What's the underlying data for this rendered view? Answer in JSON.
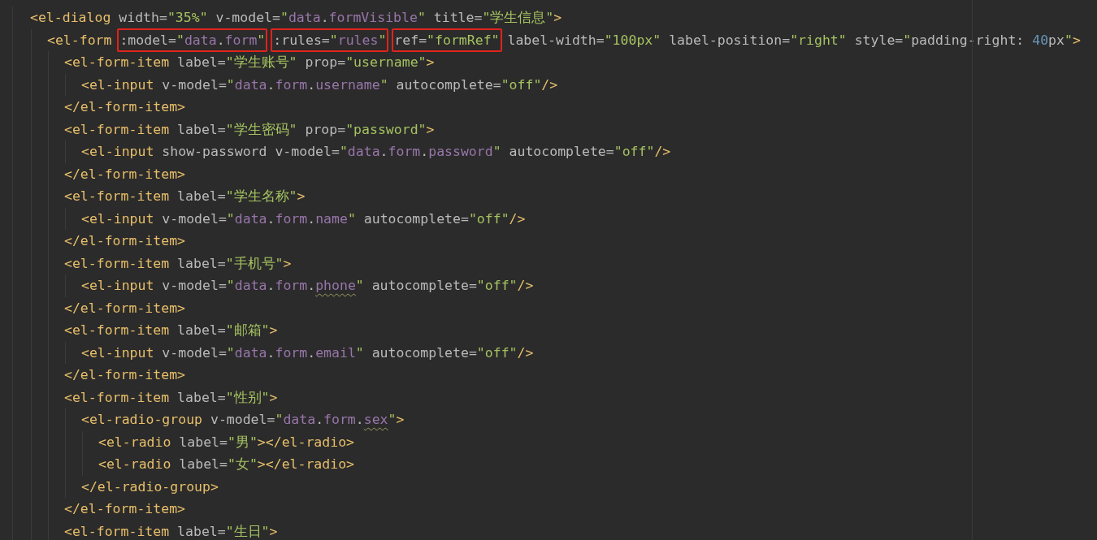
{
  "editor": {
    "lines": [
      {
        "tokens": [
          {
            "kind": "tag",
            "text": "<el-dialog "
          },
          {
            "kind": "attr",
            "text": "width="
          },
          {
            "kind": "str",
            "text": "\"35%\" "
          },
          {
            "kind": "attr",
            "text": "v-model="
          },
          {
            "kind": "str",
            "text": "\""
          },
          {
            "kind": "ref",
            "text": "data"
          },
          {
            "kind": "attr",
            "text": "."
          },
          {
            "kind": "ref",
            "text": "formVisible"
          },
          {
            "kind": "str",
            "text": "\" "
          },
          {
            "kind": "attr",
            "text": "title="
          },
          {
            "kind": "str",
            "text": "\"学生信息\""
          },
          {
            "kind": "tag",
            "text": ">"
          }
        ],
        "children": [
          {
            "tokens": [
              {
                "kind": "tag",
                "text": "<el-form "
              },
              {
                "kind": "box",
                "tokens": [
                  {
                    "kind": "attr",
                    "text": ":model="
                  },
                  {
                    "kind": "str",
                    "text": "\""
                  },
                  {
                    "kind": "ref",
                    "text": "data"
                  },
                  {
                    "kind": "attr",
                    "text": "."
                  },
                  {
                    "kind": "ref",
                    "text": "form"
                  },
                  {
                    "kind": "str",
                    "text": "\""
                  }
                ]
              },
              {
                "kind": "box",
                "tokens": [
                  {
                    "kind": "attr",
                    "text": ":rules="
                  },
                  {
                    "kind": "str",
                    "text": "\""
                  },
                  {
                    "kind": "ref",
                    "text": "rules"
                  },
                  {
                    "kind": "str",
                    "text": "\""
                  }
                ]
              },
              {
                "kind": "box",
                "tokens": [
                  {
                    "kind": "attr",
                    "text": "ref="
                  },
                  {
                    "kind": "str",
                    "text": "\"formRef\""
                  }
                ]
              },
              {
                "kind": "attr",
                "text": " label-width="
              },
              {
                "kind": "str",
                "text": "\"100px\" "
              },
              {
                "kind": "attr",
                "text": "label-position="
              },
              {
                "kind": "str",
                "text": "\"right\" "
              },
              {
                "kind": "attr",
                "text": "style="
              },
              {
                "kind": "str",
                "text": "\""
              },
              {
                "kind": "attr",
                "text": "padding-right: "
              },
              {
                "kind": "num",
                "text": "40"
              },
              {
                "kind": "attr",
                "text": "px"
              },
              {
                "kind": "str",
                "text": "\""
              },
              {
                "kind": "tag",
                "text": ">"
              }
            ],
            "children": [
              {
                "tokens": [
                  {
                    "kind": "tag",
                    "text": "<el-form-item "
                  },
                  {
                    "kind": "attr",
                    "text": "label="
                  },
                  {
                    "kind": "str",
                    "text": "\"学生账号\" "
                  },
                  {
                    "kind": "attr",
                    "text": "prop="
                  },
                  {
                    "kind": "str",
                    "text": "\"username\""
                  },
                  {
                    "kind": "tag",
                    "text": ">"
                  }
                ],
                "children": [
                  {
                    "tokens": [
                      {
                        "kind": "tag",
                        "text": "<el-input "
                      },
                      {
                        "kind": "attr",
                        "text": "v-model="
                      },
                      {
                        "kind": "str",
                        "text": "\""
                      },
                      {
                        "kind": "ref",
                        "text": "data"
                      },
                      {
                        "kind": "attr",
                        "text": "."
                      },
                      {
                        "kind": "ref",
                        "text": "form"
                      },
                      {
                        "kind": "attr",
                        "text": "."
                      },
                      {
                        "kind": "ref",
                        "text": "username"
                      },
                      {
                        "kind": "str",
                        "text": "\" "
                      },
                      {
                        "kind": "attr",
                        "text": "autocomplete="
                      },
                      {
                        "kind": "str",
                        "text": "\"off\""
                      },
                      {
                        "kind": "tag",
                        "text": "/>"
                      }
                    ]
                  }
                ]
              },
              {
                "tokens": [
                  {
                    "kind": "tag",
                    "text": "</el-form-item>"
                  }
                ]
              },
              {
                "tokens": [
                  {
                    "kind": "tag",
                    "text": "<el-form-item "
                  },
                  {
                    "kind": "attr",
                    "text": "label="
                  },
                  {
                    "kind": "str",
                    "text": "\"学生密码\" "
                  },
                  {
                    "kind": "attr",
                    "text": "prop="
                  },
                  {
                    "kind": "str",
                    "text": "\"password\""
                  },
                  {
                    "kind": "tag",
                    "text": ">"
                  }
                ],
                "children": [
                  {
                    "tokens": [
                      {
                        "kind": "tag",
                        "text": "<el-input "
                      },
                      {
                        "kind": "attr",
                        "text": "show-password v-model="
                      },
                      {
                        "kind": "str",
                        "text": "\""
                      },
                      {
                        "kind": "ref",
                        "text": "data"
                      },
                      {
                        "kind": "attr",
                        "text": "."
                      },
                      {
                        "kind": "ref",
                        "text": "form"
                      },
                      {
                        "kind": "attr",
                        "text": "."
                      },
                      {
                        "kind": "ref",
                        "text": "password"
                      },
                      {
                        "kind": "str",
                        "text": "\" "
                      },
                      {
                        "kind": "attr",
                        "text": "autocomplete="
                      },
                      {
                        "kind": "str",
                        "text": "\"off\""
                      },
                      {
                        "kind": "tag",
                        "text": "/>"
                      }
                    ]
                  }
                ]
              },
              {
                "tokens": [
                  {
                    "kind": "tag",
                    "text": "</el-form-item>"
                  }
                ]
              },
              {
                "tokens": [
                  {
                    "kind": "tag",
                    "text": "<el-form-item "
                  },
                  {
                    "kind": "attr",
                    "text": "label="
                  },
                  {
                    "kind": "str",
                    "text": "\"学生名称\""
                  },
                  {
                    "kind": "tag",
                    "text": ">"
                  }
                ],
                "children": [
                  {
                    "tokens": [
                      {
                        "kind": "tag",
                        "text": "<el-input "
                      },
                      {
                        "kind": "attr",
                        "text": "v-model="
                      },
                      {
                        "kind": "str",
                        "text": "\""
                      },
                      {
                        "kind": "ref",
                        "text": "data"
                      },
                      {
                        "kind": "attr",
                        "text": "."
                      },
                      {
                        "kind": "ref",
                        "text": "form"
                      },
                      {
                        "kind": "attr",
                        "text": "."
                      },
                      {
                        "kind": "ref",
                        "text": "name"
                      },
                      {
                        "kind": "str",
                        "text": "\" "
                      },
                      {
                        "kind": "attr",
                        "text": "autocomplete="
                      },
                      {
                        "kind": "str",
                        "text": "\"off\""
                      },
                      {
                        "kind": "tag",
                        "text": "/>"
                      }
                    ]
                  }
                ]
              },
              {
                "tokens": [
                  {
                    "kind": "tag",
                    "text": "</el-form-item>"
                  }
                ]
              },
              {
                "tokens": [
                  {
                    "kind": "tag",
                    "text": "<el-form-item "
                  },
                  {
                    "kind": "attr",
                    "text": "label="
                  },
                  {
                    "kind": "str",
                    "text": "\"手机号\""
                  },
                  {
                    "kind": "tag",
                    "text": ">"
                  }
                ],
                "children": [
                  {
                    "tokens": [
                      {
                        "kind": "tag",
                        "text": "<el-input "
                      },
                      {
                        "kind": "attr",
                        "text": "v-model="
                      },
                      {
                        "kind": "str",
                        "text": "\""
                      },
                      {
                        "kind": "ref",
                        "text": "data"
                      },
                      {
                        "kind": "attr",
                        "text": "."
                      },
                      {
                        "kind": "ref",
                        "text": "form"
                      },
                      {
                        "kind": "attr",
                        "text": "."
                      },
                      {
                        "kind": "warn",
                        "text": "phone"
                      },
                      {
                        "kind": "str",
                        "text": "\" "
                      },
                      {
                        "kind": "attr",
                        "text": "autocomplete="
                      },
                      {
                        "kind": "str",
                        "text": "\"off\""
                      },
                      {
                        "kind": "tag",
                        "text": "/>"
                      }
                    ]
                  }
                ]
              },
              {
                "tokens": [
                  {
                    "kind": "tag",
                    "text": "</el-form-item>"
                  }
                ]
              },
              {
                "tokens": [
                  {
                    "kind": "tag",
                    "text": "<el-form-item "
                  },
                  {
                    "kind": "attr",
                    "text": "label="
                  },
                  {
                    "kind": "str",
                    "text": "\"邮箱\""
                  },
                  {
                    "kind": "tag",
                    "text": ">"
                  }
                ],
                "children": [
                  {
                    "tokens": [
                      {
                        "kind": "tag",
                        "text": "<el-input "
                      },
                      {
                        "kind": "attr",
                        "text": "v-model="
                      },
                      {
                        "kind": "str",
                        "text": "\""
                      },
                      {
                        "kind": "ref",
                        "text": "data"
                      },
                      {
                        "kind": "attr",
                        "text": "."
                      },
                      {
                        "kind": "ref",
                        "text": "form"
                      },
                      {
                        "kind": "attr",
                        "text": "."
                      },
                      {
                        "kind": "ref",
                        "text": "email"
                      },
                      {
                        "kind": "str",
                        "text": "\" "
                      },
                      {
                        "kind": "attr",
                        "text": "autocomplete="
                      },
                      {
                        "kind": "str",
                        "text": "\"off\""
                      },
                      {
                        "kind": "tag",
                        "text": "/>"
                      }
                    ]
                  }
                ]
              },
              {
                "tokens": [
                  {
                    "kind": "tag",
                    "text": "</el-form-item>"
                  }
                ]
              },
              {
                "tokens": [
                  {
                    "kind": "tag",
                    "text": "<el-form-item "
                  },
                  {
                    "kind": "attr",
                    "text": "label="
                  },
                  {
                    "kind": "str",
                    "text": "\"性别\""
                  },
                  {
                    "kind": "tag",
                    "text": ">"
                  }
                ],
                "children": [
                  {
                    "tokens": [
                      {
                        "kind": "tag",
                        "text": "<el-radio-group "
                      },
                      {
                        "kind": "attr",
                        "text": "v-model="
                      },
                      {
                        "kind": "str",
                        "text": "\""
                      },
                      {
                        "kind": "ref",
                        "text": "data"
                      },
                      {
                        "kind": "attr",
                        "text": "."
                      },
                      {
                        "kind": "ref",
                        "text": "form"
                      },
                      {
                        "kind": "attr",
                        "text": "."
                      },
                      {
                        "kind": "warn",
                        "text": "sex"
                      },
                      {
                        "kind": "str",
                        "text": "\""
                      },
                      {
                        "kind": "tag",
                        "text": ">"
                      }
                    ],
                    "children": [
                      {
                        "tokens": [
                          {
                            "kind": "tag",
                            "text": "<el-radio "
                          },
                          {
                            "kind": "attr",
                            "text": "label="
                          },
                          {
                            "kind": "str",
                            "text": "\"男\""
                          },
                          {
                            "kind": "tag",
                            "text": "></el-radio>"
                          }
                        ]
                      },
                      {
                        "tokens": [
                          {
                            "kind": "tag",
                            "text": "<el-radio "
                          },
                          {
                            "kind": "attr",
                            "text": "label="
                          },
                          {
                            "kind": "str",
                            "text": "\"女\""
                          },
                          {
                            "kind": "tag",
                            "text": "></el-radio>"
                          }
                        ]
                      }
                    ]
                  },
                  {
                    "tokens": [
                      {
                        "kind": "tag",
                        "text": "</el-radio-group>"
                      }
                    ]
                  }
                ]
              },
              {
                "tokens": [
                  {
                    "kind": "tag",
                    "text": "</el-form-item>"
                  }
                ]
              },
              {
                "tokens": [
                  {
                    "kind": "tag",
                    "text": "<el-form-item "
                  },
                  {
                    "kind": "attr",
                    "text": "label="
                  },
                  {
                    "kind": "str",
                    "text": "\"生日\""
                  },
                  {
                    "kind": "tag",
                    "text": ">"
                  }
                ]
              }
            ]
          }
        ]
      }
    ]
  }
}
